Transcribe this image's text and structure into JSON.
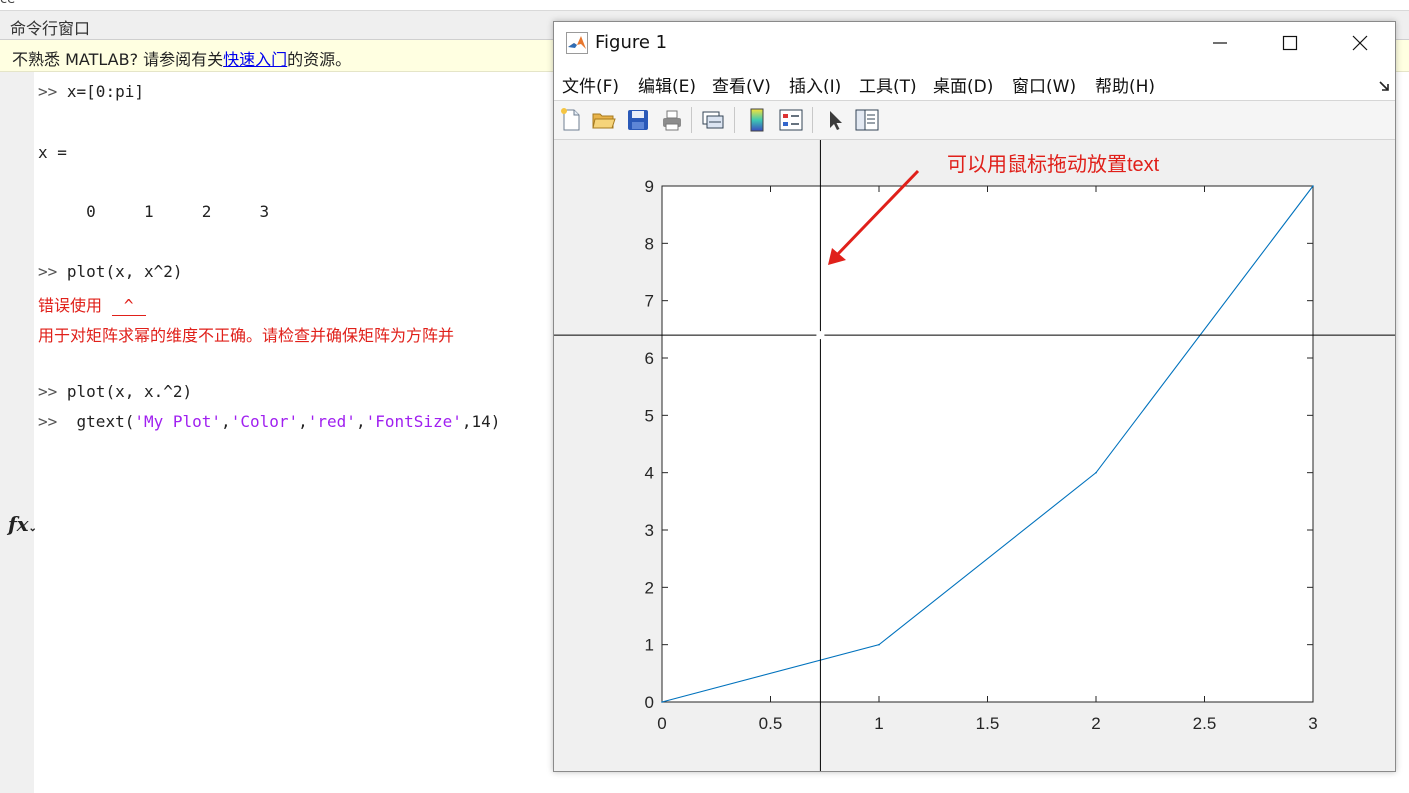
{
  "window": {
    "top_fragment": "ce",
    "title": "命令行窗口"
  },
  "banner": {
    "prefix": "不熟悉 MATLAB? 请参阅有关",
    "link": "快速入门",
    "suffix": "的资源。"
  },
  "gutter": {
    "fx_label": "fx",
    "fx_arrow": "⌄"
  },
  "console": {
    "lines": [
      {
        "prompt": ">>",
        "code": "x=[0:pi]"
      },
      {
        "text": "x ="
      },
      {
        "text": "     0     1     2     3"
      },
      {
        "prompt": ">>",
        "code": "plot(x, x^2)"
      },
      {
        "err_label": "错误使用 ",
        "err_op": "^"
      },
      {
        "err_text": "用于对矩阵求幂的维度不正确。请检查并确保矩阵为方阵并"
      },
      {
        "prompt": ">>",
        "code": "plot(x, x.^2)"
      },
      {
        "prompt": ">>",
        "code_pre": " gtext(",
        "s1": "'My Plot'",
        "c1": ",",
        "s2": "'Color'",
        "c2": ",",
        "s3": "'red'",
        "c3": ",",
        "s4": "'FontSize'",
        "code_post": ",14)"
      }
    ]
  },
  "figure": {
    "title": "Figure 1",
    "menus": [
      "文件(F)",
      "编辑(E)",
      "查看(V)",
      "插入(I)",
      "工具(T)",
      "桌面(D)",
      "窗口(W)",
      "帮助(H)"
    ],
    "toolbar": [
      "new-figure-icon",
      "open-file-icon",
      "save-icon",
      "print-icon",
      "link-plot-icon",
      "colorbar-icon",
      "legend-icon",
      "edit-plot-arrow-icon",
      "property-inspector-icon"
    ],
    "annotation": "可以用鼠标拖动放置text",
    "line_color": "#0072bd",
    "annotation_color": "#e0201a"
  },
  "chart_data": {
    "type": "line",
    "x": [
      0,
      1,
      2,
      3
    ],
    "series": [
      {
        "values": [
          0,
          1,
          4,
          9
        ]
      }
    ],
    "xlim": [
      0,
      3
    ],
    "ylim": [
      0,
      9
    ],
    "xticks": [
      0,
      0.5,
      1,
      1.5,
      2,
      2.5,
      3
    ],
    "yticks": [
      0,
      1,
      2,
      3,
      4,
      5,
      6,
      7,
      8,
      9
    ],
    "crosshair": {
      "x": 0.73,
      "y": 6.4
    },
    "grid": false
  }
}
